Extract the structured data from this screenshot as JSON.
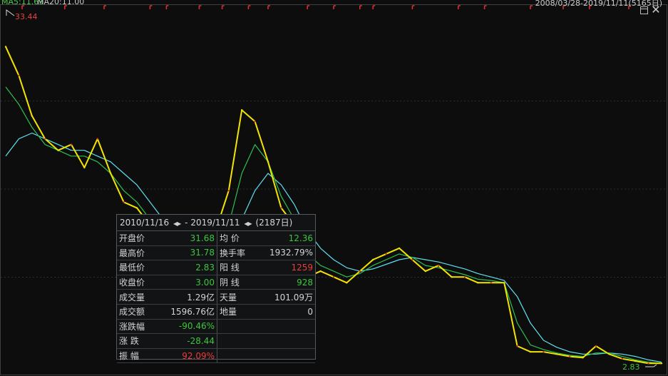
{
  "header": {
    "ma_left_1": "MA5:11.69",
    "ma_left_2": "MA20:11.00",
    "date_range": "2008/03/28-2019/11/11(5165日)"
  },
  "markers": {
    "max_price": "33.44",
    "min_price": "2.83"
  },
  "info_panel": {
    "start_date": "2010/11/16",
    "end_date": "2019/11/11",
    "days": "(2187日)",
    "rows": [
      {
        "label": "开盘价",
        "value": "31.68",
        "value_color": "down",
        "label2": "均  价",
        "value2": "12.36",
        "value2_color": "down"
      },
      {
        "label": "最高价",
        "value": "31.78",
        "value_color": "down",
        "label2": "换手率",
        "value2": "1932.79%",
        "value2_color": ""
      },
      {
        "label": "最低价",
        "value": "2.83",
        "value_color": "down",
        "label2": "阳  线",
        "value2": "1259",
        "value2_color": "up"
      },
      {
        "label": "收盘价",
        "value": "3.00",
        "value_color": "down",
        "label2": "阴  线",
        "value2": "928",
        "value2_color": "down"
      },
      {
        "label": "成交量",
        "value": "1.29亿",
        "value_color": "",
        "label2": "天量",
        "value2": "101.09万",
        "value2_color": ""
      },
      {
        "label": "成交额",
        "value": "1596.76亿",
        "value_color": "",
        "label2": "地量",
        "value2": "0",
        "value2_color": ""
      },
      {
        "label": "涨跌幅",
        "value": "-90.46%",
        "value_color": "down",
        "label2": "",
        "value2": "",
        "value2_color": ""
      },
      {
        "label": "涨  跌",
        "value": "-28.44",
        "value_color": "down",
        "label2": "",
        "value2": "",
        "value2_color": ""
      },
      {
        "label": "振  幅",
        "value": "92.09%",
        "value_color": "up",
        "label2": "",
        "value2": "",
        "value2_color": ""
      }
    ]
  },
  "chart_data": {
    "type": "line",
    "title": "",
    "xlabel": "",
    "ylabel": "",
    "ylim": [
      2.83,
      33.44
    ],
    "grid": true,
    "colors": {
      "price": "#f2e400",
      "ma_short": "#2fbf4f",
      "ma_long": "#5ee0ee",
      "up_bar": "#e23030",
      "max_marker": "#e84040",
      "min_marker": "#3fbf3f",
      "event_flag": "#e23030"
    },
    "x": [
      0,
      2,
      4,
      6,
      8,
      10,
      12,
      14,
      16,
      18,
      20,
      22,
      24,
      26,
      28,
      30,
      32,
      34,
      36,
      38,
      40,
      42,
      44,
      46,
      48,
      50,
      52,
      54,
      56,
      58,
      60,
      62,
      64,
      66,
      68,
      70,
      72,
      74,
      76,
      78,
      80,
      82,
      84,
      86,
      88,
      90,
      92,
      94,
      96,
      98,
      100
    ],
    "series": [
      {
        "name": "price",
        "values": [
          30.5,
          28.0,
          24.5,
          22.5,
          21.5,
          22.0,
          20.0,
          22.5,
          19.5,
          17.0,
          16.5,
          15.0,
          13.0,
          12.5,
          12.0,
          12.5,
          14.5,
          18.0,
          25.0,
          24.0,
          20.5,
          16.5,
          15.0,
          10.5,
          11.0,
          10.5,
          10.0,
          11.0,
          12.0,
          12.5,
          13.0,
          12.0,
          11.0,
          11.5,
          10.5,
          10.5,
          10.0,
          10.0,
          10.0,
          4.5,
          4.0,
          4.0,
          3.8,
          3.6,
          3.5,
          4.5,
          3.8,
          3.4,
          3.2,
          3.0,
          3.0
        ]
      },
      {
        "name": "ma_short",
        "values": [
          27.0,
          25.5,
          23.5,
          22.0,
          21.5,
          21.0,
          21.0,
          20.5,
          19.5,
          18.0,
          17.0,
          15.5,
          14.0,
          13.0,
          12.5,
          12.5,
          13.0,
          15.0,
          19.5,
          22.0,
          20.5,
          17.5,
          15.5,
          12.5,
          11.5,
          11.0,
          10.5,
          10.8,
          11.5,
          12.0,
          12.5,
          12.2,
          11.5,
          11.3,
          11.0,
          10.7,
          10.3,
          10.2,
          10.0,
          6.5,
          4.6,
          4.2,
          3.9,
          3.7,
          3.6,
          3.9,
          3.9,
          3.6,
          3.3,
          3.1,
          3.0
        ]
      },
      {
        "name": "ma_long",
        "values": [
          21.0,
          22.5,
          23.0,
          22.5,
          22.0,
          21.5,
          21.5,
          21.0,
          20.5,
          19.5,
          18.5,
          17.0,
          15.5,
          14.0,
          13.2,
          12.8,
          12.8,
          13.5,
          15.5,
          18.0,
          19.5,
          18.5,
          16.8,
          14.5,
          13.0,
          12.0,
          11.3,
          11.0,
          11.2,
          11.6,
          12.0,
          12.2,
          12.0,
          11.8,
          11.5,
          11.2,
          10.8,
          10.5,
          10.2,
          8.8,
          6.5,
          5.0,
          4.4,
          4.0,
          3.8,
          3.8,
          3.9,
          3.8,
          3.6,
          3.3,
          3.1
        ]
      }
    ],
    "event_flags_x": [
      2.5,
      9,
      15,
      22,
      24.5,
      29.5,
      33,
      37,
      40,
      46,
      50,
      54,
      56,
      62,
      69,
      73,
      80,
      85,
      89,
      95
    ]
  }
}
